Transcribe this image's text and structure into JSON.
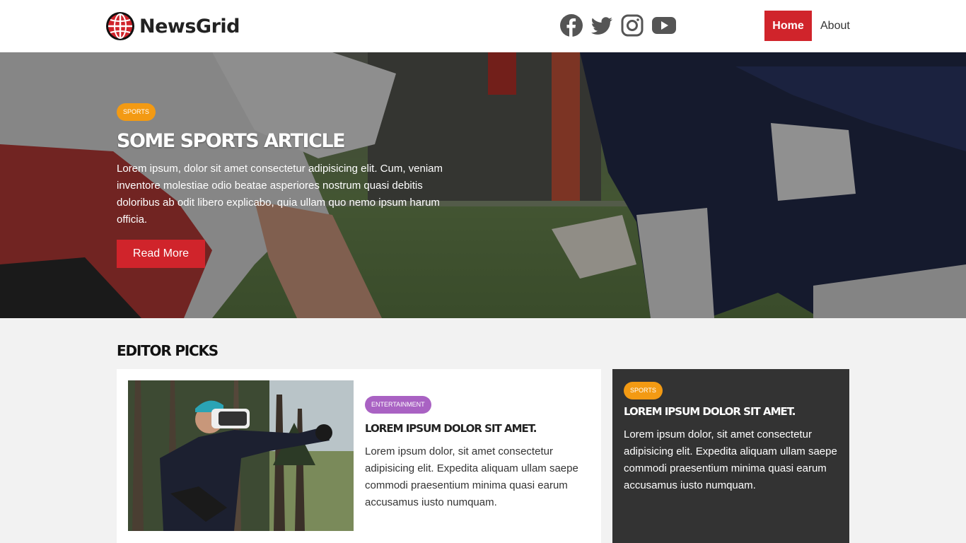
{
  "header": {
    "logo_text": "NewsGrid",
    "logo_icon": "globe-icon",
    "socials": [
      {
        "name": "facebook-icon"
      },
      {
        "name": "twitter-icon"
      },
      {
        "name": "instagram-icon"
      },
      {
        "name": "youtube-icon"
      }
    ],
    "nav": {
      "home": "Home",
      "about": "About"
    }
  },
  "hero": {
    "category": "Sports",
    "title": "Some Sports Article",
    "text": "Lorem ipsum, dolor sit amet consectetur adipisicing elit. Cum, veniam inventore molestiae odio beatae asperiores nostrum quasi debitis doloribus ab odit libero explicabo, quia ullam quo nemo ipsum harum officia.",
    "button": "Read More"
  },
  "editor_picks": {
    "title": "Editor Picks",
    "main": {
      "category": "Entertainment",
      "title": "Lorem ipsum dolor sit amet.",
      "text": "Lorem ipsum dolor, sit amet consectetur adipisicing elit. Expedita aliquam ullam saepe commodi praesentium minima quasi earum accusamus iusto numquam."
    },
    "side": {
      "category": "Sports",
      "title": "Lorem ipsum dolor sit amet.",
      "text": "Lorem ipsum dolor, sit amet consectetur adipisicing elit. Expedita aliquam ullam saepe commodi praesentium minima quasi earum accusamus iusto numquam."
    }
  },
  "colors": {
    "brand_red": "#d0242b",
    "sports_badge": "#f39a13",
    "entertainment_badge": "#a962c3",
    "dark_card": "#333333"
  }
}
